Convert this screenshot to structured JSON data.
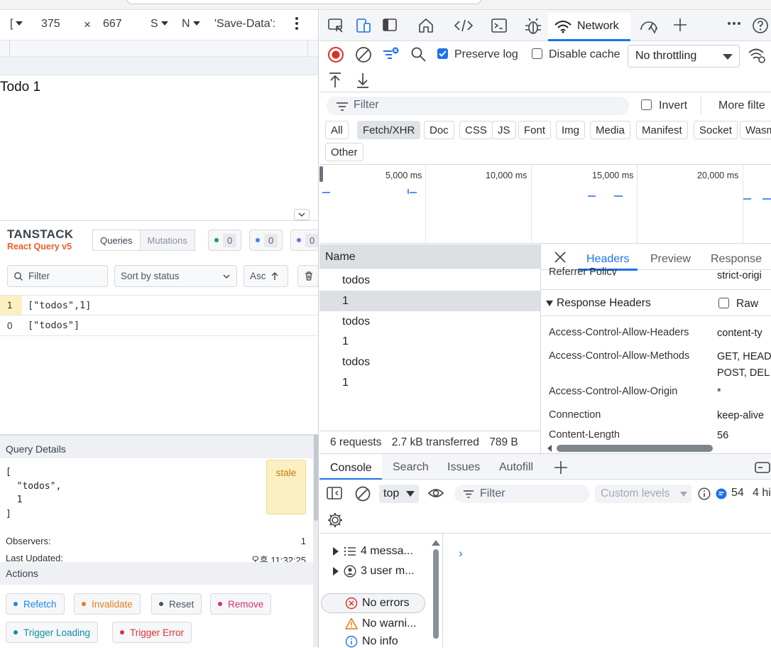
{
  "device_toolbar": {
    "dimensions_label": "[",
    "width": "375",
    "times": "×",
    "height": "667",
    "zoom_label": "S",
    "throttle_label": "N",
    "save_data": "'Save-Data':",
    "more_icon": "kebab-icon"
  },
  "page": {
    "todo_text": "Todo 1"
  },
  "tanstack": {
    "brand_title": "TANSTACK",
    "brand_sub": "React Query v5",
    "queries_label": "Queries",
    "mutations_label": "Mutations",
    "counts": [
      {
        "color": "#16a34a",
        "value": "0"
      },
      {
        "color": "#3b82f6",
        "value": "0"
      },
      {
        "color": "#8b5cf6",
        "value": "0"
      }
    ],
    "filter_placeholder": "Filter",
    "sort_label": "Sort by status",
    "order_label": "Asc",
    "queries": [
      {
        "count": "1",
        "key": "[\"todos\",1]",
        "highlight": "#fcefc2"
      },
      {
        "count": "0",
        "key": "[\"todos\"]",
        "highlight": ""
      }
    ],
    "details": {
      "title": "Query Details",
      "json_lines": [
        "[",
        "  \"todos\",",
        "  1",
        "]"
      ],
      "status": "stale",
      "observers_label": "Observers:",
      "observers_value": "1",
      "updated_label": "Last Updated:",
      "updated_value": "오후 11:32:25"
    },
    "actions": {
      "title": "Actions",
      "buttons": [
        {
          "label": "Refetch",
          "color": "#1e88e5"
        },
        {
          "label": "Invalidate",
          "color": "#e67e22"
        },
        {
          "label": "Reset",
          "color": "#4b5563"
        },
        {
          "label": "Remove",
          "color": "#d6336c"
        },
        {
          "label": "Trigger Loading",
          "color": "#0e8fa3"
        },
        {
          "label": "Trigger Error",
          "color": "#e03131"
        }
      ]
    }
  },
  "devtools": {
    "active_tab": "Network",
    "toolbar": {
      "preserve_log": "Preserve log",
      "preserve_checked": true,
      "disable_cache": "Disable cache",
      "throttling": "No throttling"
    },
    "filter": {
      "placeholder": "Filter",
      "invert": "Invert",
      "more": "More filte"
    },
    "type_chips": [
      "All",
      "Fetch/XHR",
      "Doc",
      "CSS",
      "JS",
      "Font",
      "Img",
      "Media",
      "Manifest",
      "Socket",
      "Wasm"
    ],
    "other_chip": "Other",
    "timeline_labels": [
      "5,000 ms",
      "10,000 ms",
      "15,000 ms",
      "20,000 ms"
    ],
    "name_header": "Name",
    "requests": [
      "todos",
      "1",
      "todos",
      "1",
      "todos",
      "1"
    ],
    "summary": {
      "requests": "6 requests",
      "transferred": "2.7 kB transferred",
      "resources": "789 B"
    },
    "headers_panel": {
      "tabs": [
        "Headers",
        "Preview",
        "Response"
      ],
      "referrer_name": "Referrer Policy",
      "referrer_value": "strict-origi",
      "section": "Response Headers",
      "raw": "Raw",
      "rows": [
        {
          "name": "Access-Control-Allow-Headers",
          "value": "content-ty"
        },
        {
          "name": "Access-Control-Allow-Methods",
          "value": "GET, HEAD",
          "value2": "POST, DEL"
        },
        {
          "name": "Access-Control-Allow-Origin",
          "value": "*"
        },
        {
          "name": "Connection",
          "value": "keep-alive"
        },
        {
          "name": "Content-Length",
          "value": "56"
        }
      ]
    },
    "drawer": {
      "tabs": [
        "Console",
        "Search",
        "Issues",
        "Autofill"
      ],
      "context": "top",
      "filter_placeholder": "Filter",
      "levels": "Custom levels",
      "message_count": "54",
      "hidden_label": "4 hi",
      "sidebar": [
        {
          "label": "4 messa...",
          "icon": "list-icon"
        },
        {
          "label": "3 user m...",
          "icon": "user-icon"
        },
        {
          "label": "No errors",
          "icon": "error-icon"
        },
        {
          "label": "No warni...",
          "icon": "warning-icon"
        },
        {
          "label": "No info",
          "icon": "info-icon"
        }
      ],
      "prompt": "›"
    }
  }
}
